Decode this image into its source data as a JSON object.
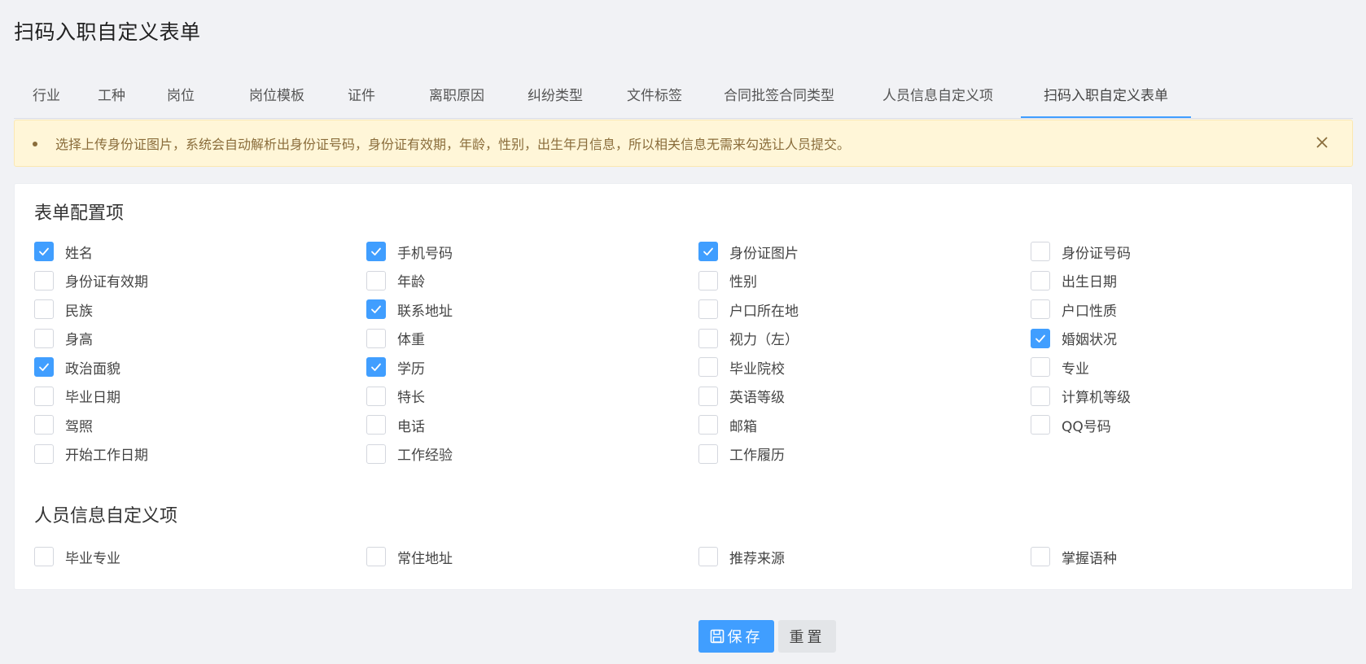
{
  "page": {
    "title": "扫码入职自定义表单"
  },
  "tabs": [
    {
      "label": "行业",
      "active": false
    },
    {
      "label": "工种",
      "active": false
    },
    {
      "label": "岗位",
      "active": false
    },
    {
      "label": "岗位模板",
      "active": false
    },
    {
      "label": "证件",
      "active": false
    },
    {
      "label": "离职原因",
      "active": false
    },
    {
      "label": "纠纷类型",
      "active": false
    },
    {
      "label": "文件标签",
      "active": false
    },
    {
      "label": "合同批签合同类型",
      "active": false
    },
    {
      "label": "人员信息自定义项",
      "active": false
    },
    {
      "label": "扫码入职自定义表单",
      "active": true
    }
  ],
  "alert": {
    "text": "选择上传身份证图片，系统会自动解析出身份证号码，身份证有效期，年龄，性别，出生年月信息，所以相关信息无需来勾选让人员提交。",
    "close_icon": "close-icon"
  },
  "form_config": {
    "title": "表单配置项",
    "items": [
      {
        "label": "姓名",
        "checked": true
      },
      {
        "label": "手机号码",
        "checked": true
      },
      {
        "label": "身份证图片",
        "checked": true
      },
      {
        "label": "身份证号码",
        "checked": false
      },
      {
        "label": "身份证有效期",
        "checked": false
      },
      {
        "label": "年龄",
        "checked": false
      },
      {
        "label": "性别",
        "checked": false
      },
      {
        "label": "出生日期",
        "checked": false
      },
      {
        "label": "民族",
        "checked": false
      },
      {
        "label": "联系地址",
        "checked": true
      },
      {
        "label": "户口所在地",
        "checked": false
      },
      {
        "label": "户口性质",
        "checked": false
      },
      {
        "label": "身高",
        "checked": false
      },
      {
        "label": "体重",
        "checked": false
      },
      {
        "label": "视力（左）",
        "checked": false
      },
      {
        "label": "婚姻状况",
        "checked": true
      },
      {
        "label": "政治面貌",
        "checked": true
      },
      {
        "label": "学历",
        "checked": true
      },
      {
        "label": "毕业院校",
        "checked": false
      },
      {
        "label": "专业",
        "checked": false
      },
      {
        "label": "毕业日期",
        "checked": false
      },
      {
        "label": "特长",
        "checked": false
      },
      {
        "label": "英语等级",
        "checked": false
      },
      {
        "label": "计算机等级",
        "checked": false
      },
      {
        "label": "驾照",
        "checked": false
      },
      {
        "label": "电话",
        "checked": false
      },
      {
        "label": "邮箱",
        "checked": false
      },
      {
        "label": "QQ号码",
        "checked": false
      },
      {
        "label": "开始工作日期",
        "checked": false
      },
      {
        "label": "工作经验",
        "checked": false
      },
      {
        "label": "工作履历",
        "checked": false
      }
    ]
  },
  "custom_items": {
    "title": "人员信息自定义项",
    "items": [
      {
        "label": "毕业专业",
        "checked": false
      },
      {
        "label": "常住地址",
        "checked": false
      },
      {
        "label": "推荐来源",
        "checked": false
      },
      {
        "label": "掌握语种",
        "checked": false
      }
    ]
  },
  "actions": {
    "save_label": "保存",
    "reset_label": "重置",
    "save_icon": "save-icon"
  },
  "colors": {
    "primary": "#409eff",
    "alert_bg": "#fff6d8",
    "alert_text": "#8a6d3b",
    "page_bg": "#f1f2f5"
  }
}
